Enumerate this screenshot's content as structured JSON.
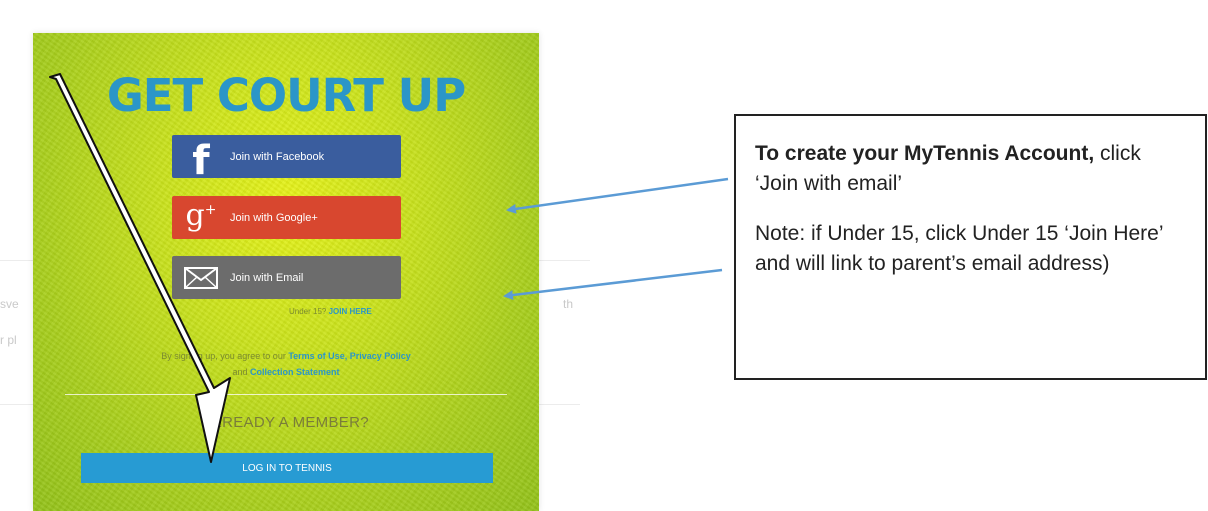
{
  "background": {
    "left_fragments": [
      "sve",
      "r pl"
    ],
    "right_fragment": "th"
  },
  "modal": {
    "title": "GET COURT UP",
    "buttons": {
      "facebook": "Join with Facebook",
      "google": "Join with Google+",
      "email": "Join with Email"
    },
    "under15": {
      "prefix": "Under 15?",
      "link": "JOIN HERE"
    },
    "terms": {
      "prefix": "By signing up, you agree to our",
      "terms_link": "Terms of Use,",
      "privacy_link": "Privacy Policy",
      "and": "and",
      "collection_link": "Collection Statement"
    },
    "already_member": "ALREADY A MEMBER?",
    "login_button": "LOG IN TO TENNIS"
  },
  "callout": {
    "line1_bold": "To create your MyTennis Account,",
    "line1_rest": " click ‘Join with email’",
    "note": "Note: if Under 15, click Under 15 ‘Join Here’ and will link to parent’s email address)"
  },
  "colors": {
    "title": "#2b96c8",
    "facebook": "#3a5d9e",
    "google": "#d8472f",
    "email": "#6c6c6c",
    "login": "#279bd3",
    "arrow": "#5b9bd5"
  },
  "icons": {
    "facebook": "facebook-icon",
    "google": "google-plus-icon",
    "email": "envelope-icon"
  }
}
